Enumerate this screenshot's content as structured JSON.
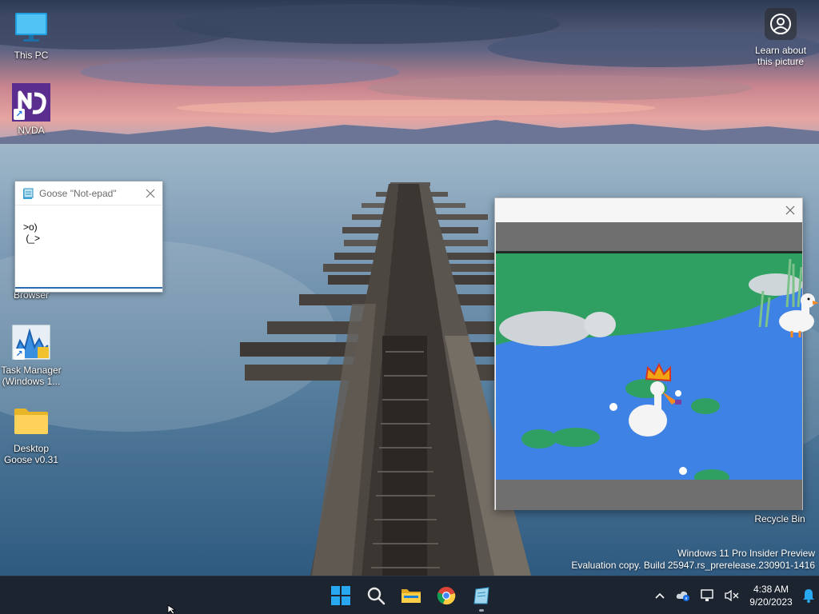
{
  "desktop": {
    "icons": [
      {
        "label": "This PC",
        "icon": "monitor-icon"
      },
      {
        "label": "NVDA",
        "icon": "nvda-icon"
      },
      {
        "label": "Browser",
        "icon": "browser-icon"
      },
      {
        "label": "Task Manager\n(Windows 1...",
        "icon": "task-manager-icon"
      },
      {
        "label": "Desktop\nGoose v0.31",
        "icon": "folder-icon"
      },
      {
        "label": "Recycle Bin",
        "icon": "recycle-bin-icon"
      }
    ],
    "learn_about": "Learn about\nthis picture"
  },
  "notepad": {
    "title": "Goose \"Not-epad\"",
    "content": ">o)\n (_>"
  },
  "watermark": {
    "line1": "Windows 11 Pro Insider Preview",
    "line2": "Evaluation copy. Build 25947.rs_prerelease.230901-1416"
  },
  "taskbar": {
    "pinned": [
      "start-icon",
      "search-icon",
      "file-explorer-icon",
      "chrome-icon",
      "notepad-icon"
    ],
    "clock": {
      "time": "4:38 AM",
      "date": "9/20/2023"
    }
  },
  "colors": {
    "taskbar_bg": "#1c2430",
    "accent": "#0a84ff",
    "water": "#3f82e6",
    "grass": "#2fa061"
  }
}
